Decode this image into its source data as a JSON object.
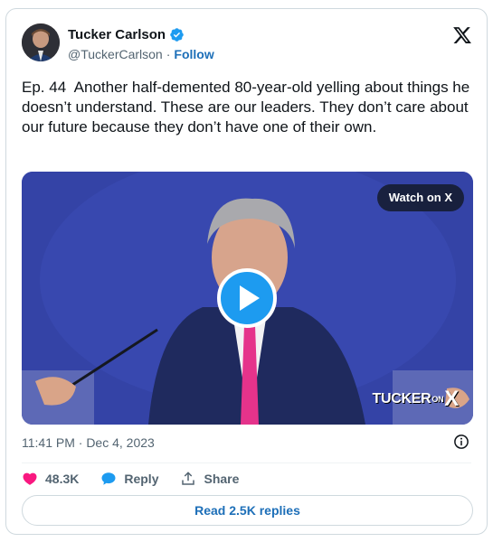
{
  "author": {
    "display_name": "Tucker Carlson",
    "handle": "@TuckerCarlson",
    "separator": "·",
    "follow_label": "Follow",
    "verified": true
  },
  "icons": {
    "platform_logo": "x-logo-icon",
    "verified": "verified-badge-icon",
    "info": "info-icon",
    "like": "heart-icon",
    "reply": "reply-icon",
    "share": "share-icon",
    "play": "play-icon"
  },
  "tweet": {
    "text": "Ep. 44  Another half-demented 80-year-old yelling about things he doesn’t understand. These are our leaders. They don’t care about our future because they don’t have one of their own."
  },
  "media": {
    "watch_label": "Watch on X",
    "watermark_text": "TUCKER",
    "watermark_suffix": "ON",
    "watermark_x": "X"
  },
  "meta": {
    "timestamp": "11:41 PM · Dec 4, 2023"
  },
  "actions": {
    "like_count": "48.3K",
    "reply_label": "Reply",
    "share_label": "Share"
  },
  "read_replies_label": "Read 2.5K replies",
  "colors": {
    "link_blue": "#1d6fb8",
    "verified_blue": "#1d9bf0",
    "like_pink": "#f91880",
    "muted_text": "#536471",
    "border": "#cfd9de",
    "video_bg": "#3442a5"
  }
}
